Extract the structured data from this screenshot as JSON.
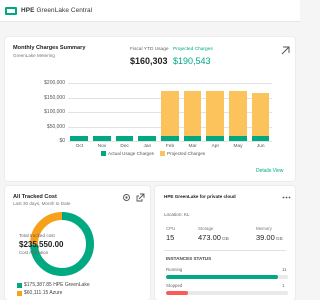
{
  "header": {
    "brand": "HPE",
    "product": "GreenLake Central"
  },
  "charges": {
    "title": "Monthly Charges Summary",
    "subtitle": "GreenLake Metering",
    "actual_label": "Fiscal YTD Usage",
    "actual_value": "$160,303",
    "forecast_label": "Projected Charges",
    "forecast_value": "$190,543",
    "expand_icon": "expand-icon",
    "link_label": "Details View",
    "legend_actual": "Actual Usage Charges",
    "legend_forecast": "Projected Charges",
    "colors": {
      "actual": "#01a982",
      "forecast": "#fcc25b"
    }
  },
  "chart_data": {
    "type": "bar",
    "categories": [
      "Oct",
      "Nov",
      "Dec",
      "Jan",
      "Feb",
      "Mar",
      "Apr",
      "May",
      "Jun"
    ],
    "series": [
      {
        "name": "Actual Usage Charges",
        "values": [
          17000,
          17000,
          17000,
          17000,
          17000,
          17000,
          17000,
          17000,
          17000
        ]
      },
      {
        "name": "Projected Charges",
        "values": [
          0,
          0,
          0,
          0,
          173000,
          173000,
          173000,
          173000,
          167000
        ]
      }
    ],
    "yticks": [
      "$200,000",
      "$150,000",
      "$100,000",
      "$50,000",
      "$0"
    ],
    "ylim": [
      0,
      200000
    ],
    "grid": true,
    "legend_position": "bottom"
  },
  "cost": {
    "title": "All Tracked Cost",
    "subtitle": "Last 30 days, Month to Date",
    "total_label": "Total tracked cost",
    "total_value": "$235,550.00",
    "total_sub": "Cost Allocation",
    "gear_icon": "gear-icon",
    "open_icon": "open-external-icon",
    "items": [
      {
        "label": "$175,387.85  HPE GreenLake",
        "color": "#01a982",
        "share": 0.745
      },
      {
        "label": "$60,111.15  Azure",
        "color": "#f7a11a",
        "share": 0.255
      }
    ]
  },
  "hpe": {
    "title": "HPE GreenLake for private cloud",
    "menu_icon": "more-icon",
    "location_label": "Location: KL",
    "stats": [
      {
        "label": "CPU",
        "value": "15",
        "unit": ""
      },
      {
        "label": "Storage",
        "value": "473.00",
        "unit": "GB"
      },
      {
        "label": "Memory",
        "value": "39.00",
        "unit": "GB"
      }
    ],
    "instances_title": "INSTANCES STATUS",
    "instances": [
      {
        "label": "Running",
        "count": "11",
        "fraction": 0.92,
        "color": "#01a982"
      },
      {
        "label": "Stopped",
        "count": "1",
        "fraction": 0.18,
        "color": "#fc5a5a"
      }
    ]
  }
}
